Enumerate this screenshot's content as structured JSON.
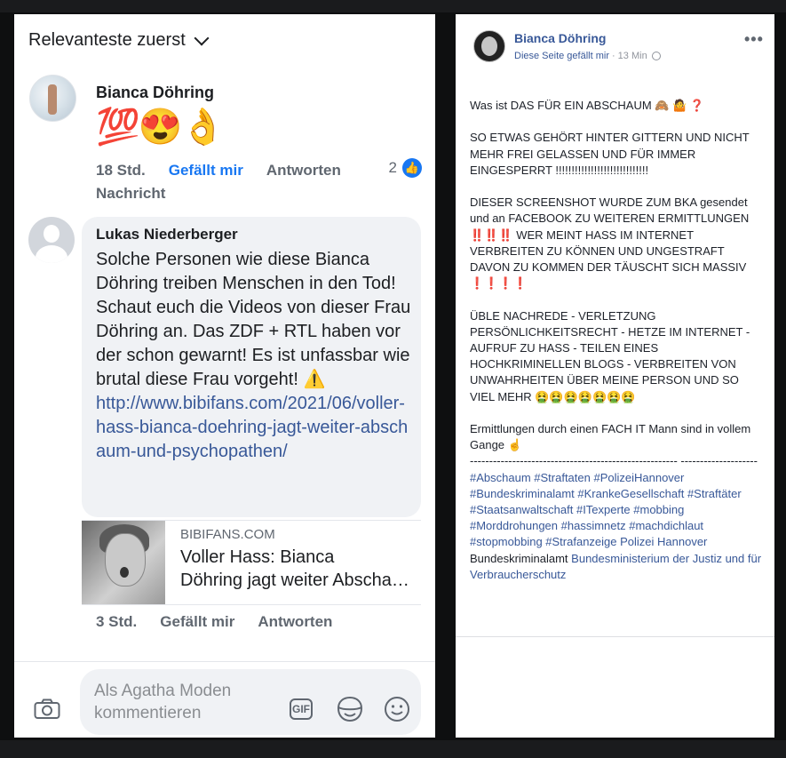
{
  "comments_panel": {
    "sort_label": "Relevanteste zuerst",
    "comment1": {
      "author": "Bianca Döhring",
      "emojis": "💯😍👌",
      "time": "18 Std.",
      "like_action": "Gefällt mir",
      "reply_action": "Antworten",
      "message_action": "Nachricht",
      "like_count": "2"
    },
    "comment2": {
      "author": "Lukas Niederberger",
      "text": "Solche Personen wie diese Bianca Döhring treiben Menschen in den Tod! Schaut euch die Videos von dieser Frau Döhring an. Das ZDF + RTL haben vor der schon gewarnt! Es ist unfassbar wie brutal diese Frau vorgeht! ⚠️",
      "link": "http://www.bibifans.com/2021/06/voller-hass-bianca-doehring-jagt-weiter-abschaum-und-psychopathen/",
      "preview_domain": "BIBIFANS.COM",
      "preview_title_line1": "Voller Hass: Bianca",
      "preview_title_line2": "Döhring jagt weiter Abschaum und Psychopathen",
      "time": "3 Std.",
      "like_action": "Gefällt mir",
      "reply_action": "Antworten"
    },
    "composer": {
      "placeholder": "Als Agatha Moden kommentieren",
      "gif_label": "GIF"
    }
  },
  "post_panel": {
    "page_name": "Bianca Döhring",
    "liked_text": "Diese Seite gefällt mir",
    "separator": "·",
    "time": "13 Min",
    "more": "•••",
    "p1": "Was ist DAS FÜR EIN ABSCHAUM 🙈 🤷 ❓",
    "p2": "SO ETWAS GEHÖRT HINTER GITTERN UND NICHT MEHR FREI GELASSEN UND FÜR IMMER EINGESPERRT !!!!!!!!!!!!!!!!!!!!!!!!!!!!!",
    "p3a": "DIESER SCREENSHOT WURDE ZUM BKA gesendet und an FACEBOOK ZU WEITEREN ERMITTLUNGEN",
    "p3b": "‼️‼️‼️",
    "p3c": "WER MEINT HASS IM INTERNET VERBREITEN ZU KÖNNEN UND UNGESTRAFT DAVON ZU KOMMEN DER TÄUSCHT SICH MASSIV",
    "p3d": "❗❗❗❗",
    "p4": "ÜBLE NACHREDE - VERLETZUNG PERSÖNLICHKEITSRECHT - HETZE IM INTERNET - AUFRUF ZU HASS - TEILEN EINES HOCHKRIMINELLEN BLOGS - VERBREITEN VON UNWAHRHEITEN ÜBER MEINE PERSON UND SO VIEL MEHR 🤮🤮🤮🤮🤮🤮🤮",
    "p5": "Ermittlungen durch einen FACH IT Mann sind in vollem Gange ☝️",
    "dashes": "------------------------------------------------------ --------------------",
    "tags1": "#Abschaum #Straftaten #PolizeiHannover #Bundeskriminalamt #KrankeGesellschaft #Straftäter #Staatsanwaltschaft #ITexperte #mobbing #Morddrohungen #hassimnetz #machdichlaut #stopmobbing #Strafanzeige Polizei Hannover",
    "plain1": "Bundeskriminalamt",
    "tags2": "Bundesministerium der Justiz und für Verbraucherschutz"
  }
}
